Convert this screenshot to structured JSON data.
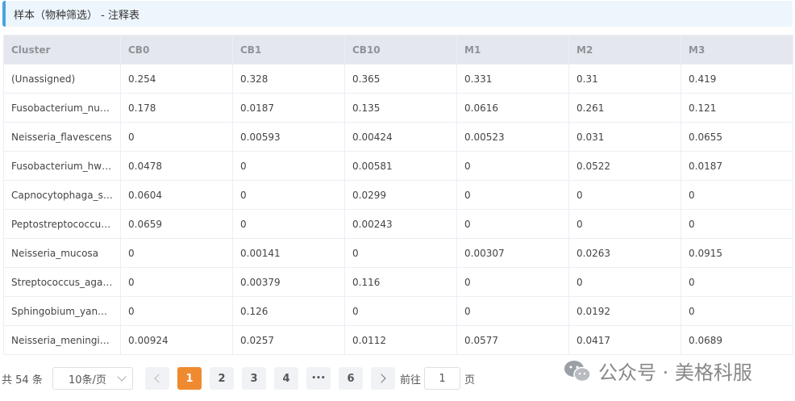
{
  "title": "样本（物种筛选） - 注释表",
  "table": {
    "headers": [
      "Cluster",
      "CB0",
      "CB1",
      "CB10",
      "M1",
      "M2",
      "M3"
    ],
    "rows": [
      [
        "(Unassigned)",
        "0.254",
        "0.328",
        "0.365",
        "0.331",
        "0.31",
        "0.419"
      ],
      [
        "Fusobacterium_nucl...",
        "0.178",
        "0.0187",
        "0.135",
        "0.0616",
        "0.261",
        "0.121"
      ],
      [
        "Neisseria_flavescens",
        "0",
        "0.00593",
        "0.00424",
        "0.00523",
        "0.031",
        "0.0655"
      ],
      [
        "Fusobacterium_hwa...",
        "0.0478",
        "0",
        "0.00581",
        "0",
        "0.0522",
        "0.0187"
      ],
      [
        "Capnocytophaga_sp...",
        "0.0604",
        "0",
        "0.0299",
        "0",
        "0",
        "0"
      ],
      [
        "Peptostreptococcus...",
        "0.0659",
        "0",
        "0.00243",
        "0",
        "0",
        "0"
      ],
      [
        "Neisseria_mucosa",
        "0",
        "0.00141",
        "0",
        "0.00307",
        "0.0263",
        "0.0915"
      ],
      [
        "Streptococcus_agal...",
        "0",
        "0.00379",
        "0.116",
        "0",
        "0",
        "0"
      ],
      [
        "Sphingobium_yanoi...",
        "0",
        "0.126",
        "0",
        "0",
        "0.0192",
        "0"
      ],
      [
        "Neisseria_meningitidis",
        "0.00924",
        "0.0257",
        "0.0112",
        "0.0577",
        "0.0417",
        "0.0689"
      ]
    ]
  },
  "pagination": {
    "total": "共 54 条",
    "page_size": "10条/页",
    "pages": [
      "1",
      "2",
      "3",
      "4",
      "•••",
      "6"
    ],
    "current": "1",
    "goto_label": "前往",
    "goto_value": "1",
    "page_suffix": "页"
  },
  "watermark": {
    "text": "公众号 · 美格科服",
    "icon": "wechat-icon"
  },
  "colors": {
    "accent": "#f08a30",
    "title_border": "#4aa3df",
    "title_bg": "#eef6fd",
    "header_bg": "#e4e7ed"
  }
}
